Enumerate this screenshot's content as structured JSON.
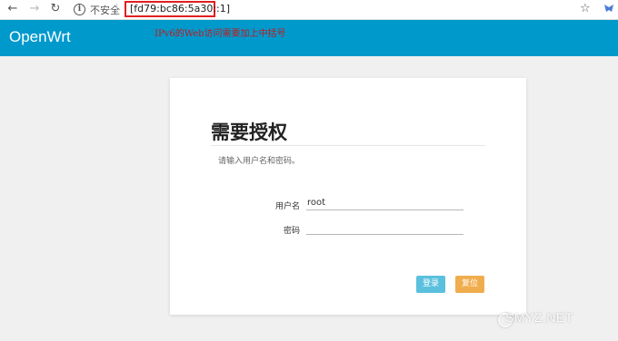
{
  "browser": {
    "back_glyph": "←",
    "forward_glyph": "→",
    "reload_glyph": "↻",
    "info_glyph": "i",
    "security_label": "不安全",
    "url": "[fd79:bc86:5a30::1]",
    "bookmark_glyph": "☆"
  },
  "header": {
    "brand": "OpenWrt",
    "annotation": "IPv6的Web访问需要加上中括号",
    "color": "#0099cc"
  },
  "login": {
    "title": "需要授权",
    "description": "请输入用户名和密码。",
    "username_label": "用户名",
    "username_value": "root",
    "password_label": "密码",
    "password_value": "",
    "login_button": "登录",
    "reset_button": "复位",
    "login_color": "#5bc0de",
    "reset_color": "#f0ad4e"
  },
  "watermark": {
    "text": "SMYZ.NET"
  }
}
